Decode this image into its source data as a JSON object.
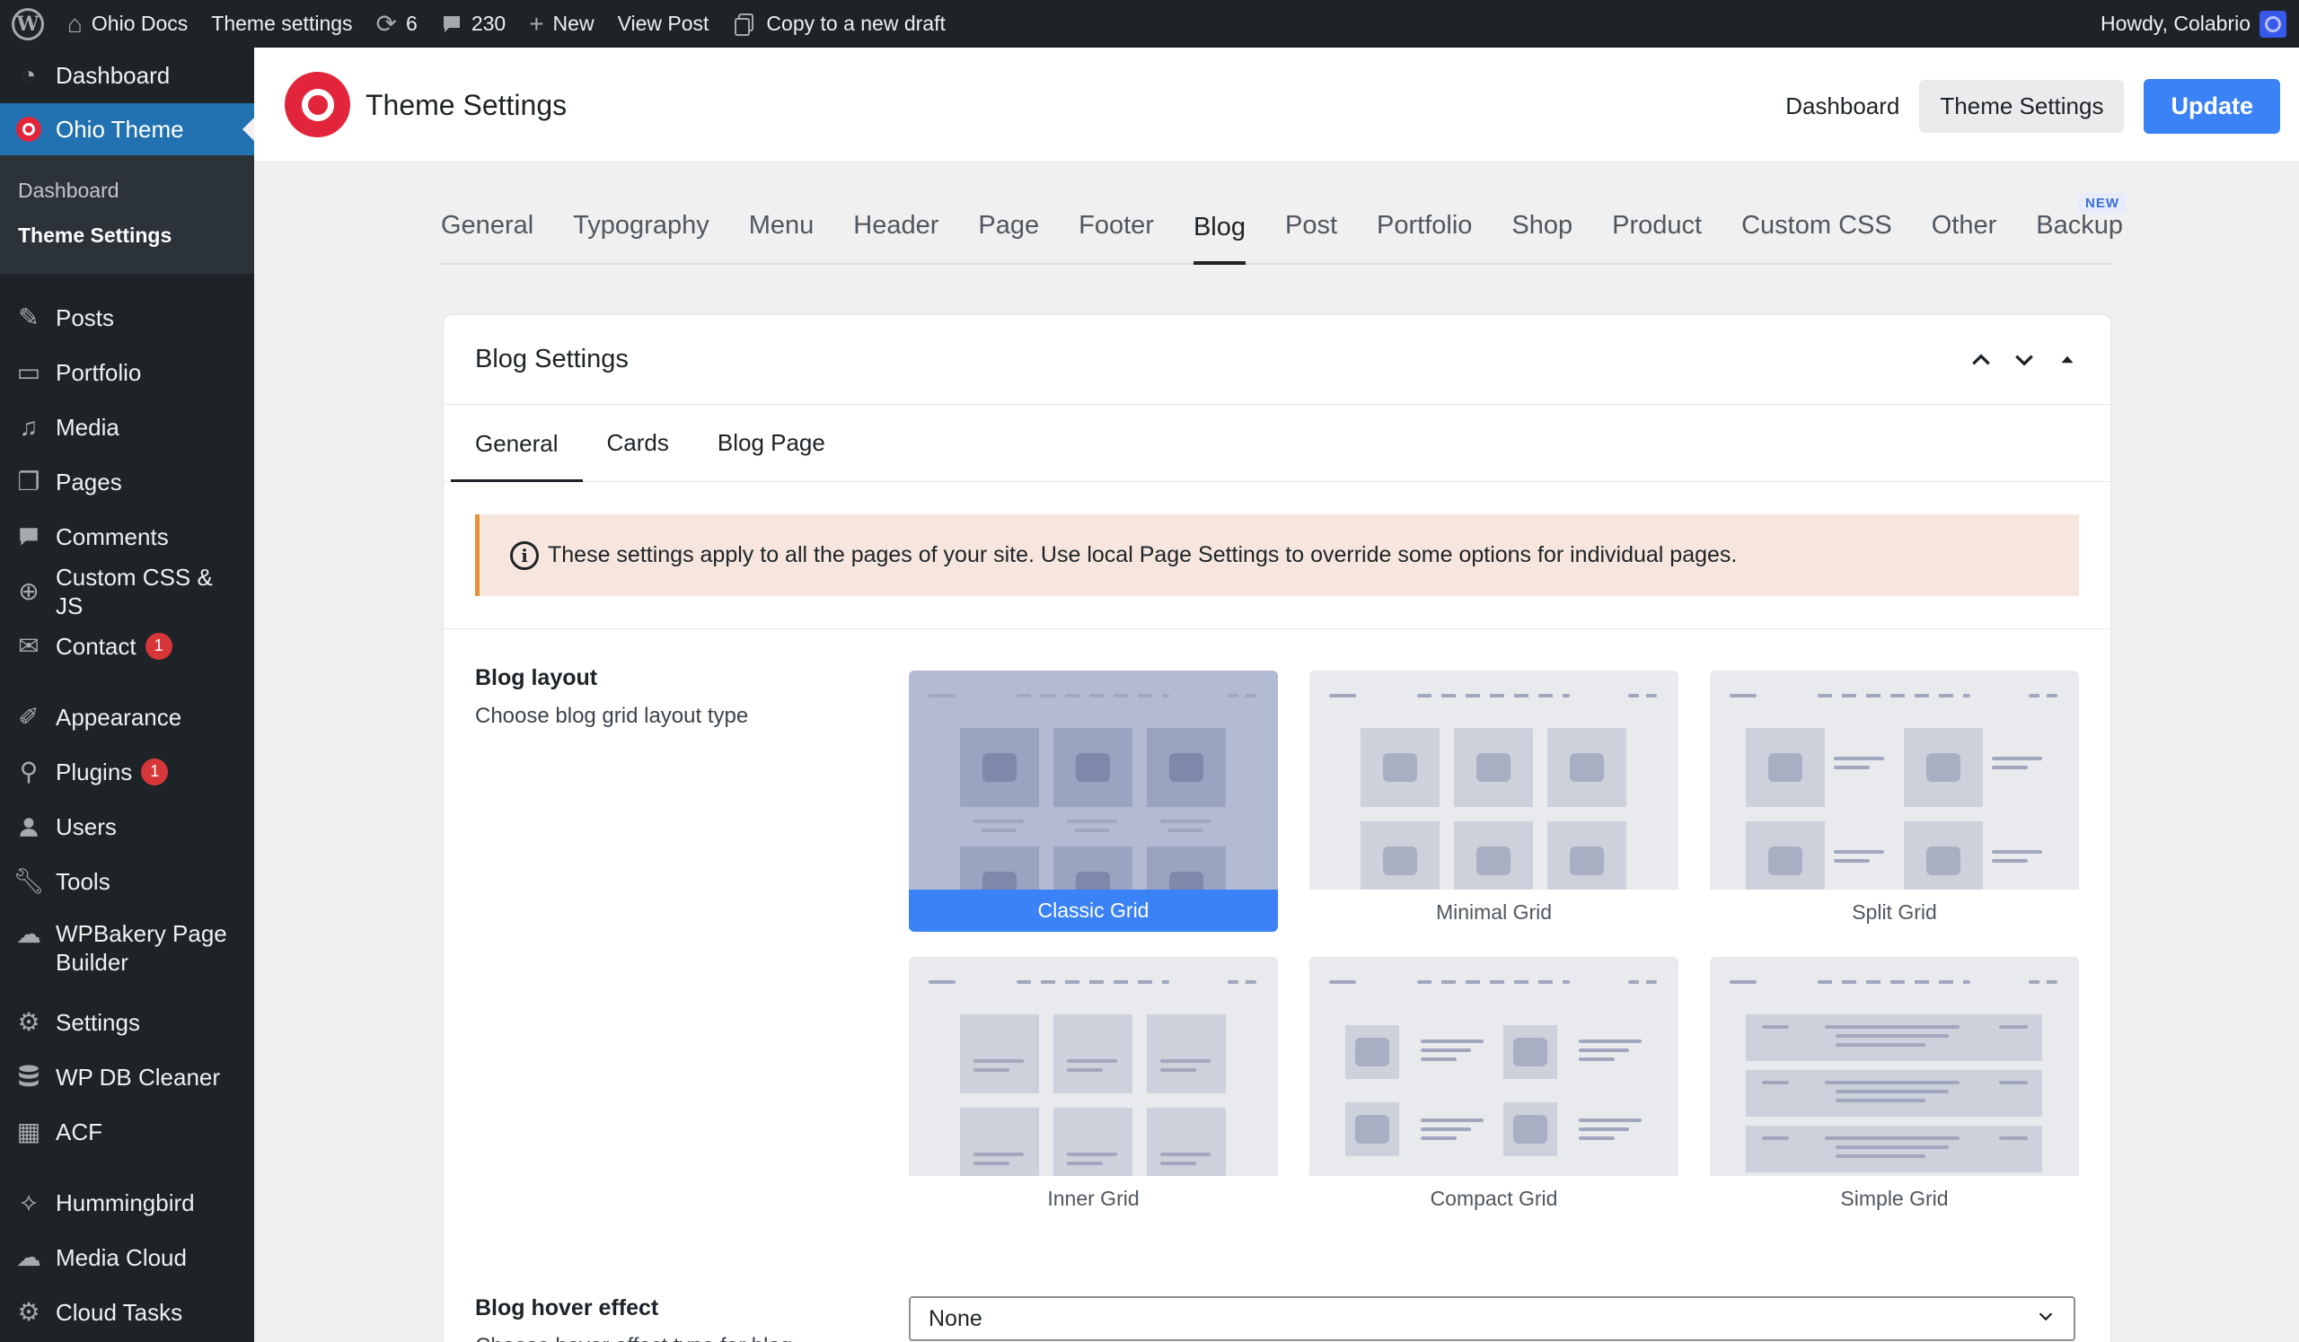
{
  "adminbar": {
    "site_name": "Ohio Docs",
    "theme_settings": "Theme settings",
    "updates_count": "6",
    "comments_count": "230",
    "new_label": "New",
    "view_post": "View Post",
    "copy_draft": "Copy to a new draft",
    "howdy": "Howdy, Colabrio"
  },
  "sidebar": {
    "dashboard": "Dashboard",
    "ohio_theme": "Ohio Theme",
    "sub_dashboard": "Dashboard",
    "sub_theme_settings": "Theme Settings",
    "items": [
      {
        "label": "Posts",
        "icon": "pin-icon"
      },
      {
        "label": "Portfolio",
        "icon": "folder-icon"
      },
      {
        "label": "Media",
        "icon": "media-icon"
      },
      {
        "label": "Pages",
        "icon": "pages-icon"
      },
      {
        "label": "Comments",
        "icon": "comments-icon"
      },
      {
        "label": "Custom CSS & JS",
        "icon": "plus-circle-icon"
      },
      {
        "label": "Contact",
        "icon": "mail-icon",
        "badge": "1"
      },
      {
        "label": "Appearance",
        "icon": "brush-icon"
      },
      {
        "label": "Plugins",
        "icon": "plugin-icon",
        "badge": "1"
      },
      {
        "label": "Users",
        "icon": "user-icon"
      },
      {
        "label": "Tools",
        "icon": "wrench-icon"
      },
      {
        "label": "WPBakery Page Builder",
        "icon": "cloud-icon"
      },
      {
        "label": "Settings",
        "icon": "settings-icon"
      },
      {
        "label": "WP DB Cleaner",
        "icon": "database-icon"
      },
      {
        "label": "ACF",
        "icon": "table-icon"
      },
      {
        "label": "Hummingbird",
        "icon": "hummingbird-icon"
      },
      {
        "label": "Media Cloud",
        "icon": "cloud-icon"
      },
      {
        "label": "Cloud Tasks",
        "icon": "gear-cloud-icon"
      }
    ]
  },
  "header": {
    "title": "Theme Settings",
    "nav_dashboard": "Dashboard",
    "nav_theme_settings": "Theme Settings",
    "update": "Update"
  },
  "tabs": [
    "General",
    "Typography",
    "Menu",
    "Header",
    "Page",
    "Footer",
    "Blog",
    "Post",
    "Portfolio",
    "Shop",
    "Product",
    "Custom CSS",
    "Other",
    "Backup"
  ],
  "active_tab": "Blog",
  "new_badge": "NEW",
  "panel": {
    "title": "Blog Settings",
    "subtabs": [
      "General",
      "Cards",
      "Blog Page"
    ],
    "notice": "These settings apply to all the pages of your site. Use local Page Settings to override some options for individual pages.",
    "blog_layout_label": "Blog layout",
    "blog_layout_desc": "Choose blog grid layout type",
    "layouts": [
      "Classic Grid",
      "Minimal Grid",
      "Split Grid",
      "Inner Grid",
      "Compact Grid",
      "Simple Grid"
    ],
    "selected_layout": "Classic Grid",
    "hover_label": "Blog hover effect",
    "hover_desc": "Choose hover effect type for blog",
    "hover_value": "None"
  },
  "colors": {
    "accent": "#3b82f6",
    "admin_dark": "#1d2327",
    "brand": "#e2253a",
    "notice_bg": "#f7e6de"
  }
}
